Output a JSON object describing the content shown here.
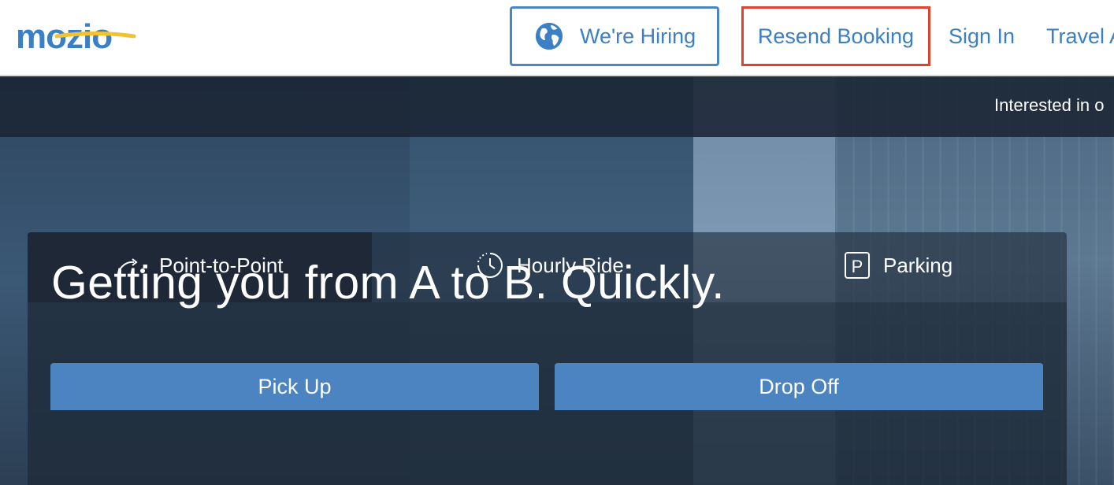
{
  "header": {
    "logo_text": "mozio",
    "nav": {
      "hiring_label": "We're Hiring",
      "resend_label": "Resend Booking",
      "signin_label": "Sign In",
      "travel_label": "Travel A"
    },
    "icons": {
      "hiring": "globe-icon"
    }
  },
  "banner": {
    "text": "Interested in o"
  },
  "booking": {
    "tabs": [
      {
        "label": "Point-to-Point",
        "icon": "route-arrow-icon",
        "active": true
      },
      {
        "label": "Hourly Ride",
        "icon": "clock-icon",
        "active": false
      },
      {
        "label": "Parking",
        "icon": "parking-icon",
        "active": false
      }
    ],
    "headline": "Getting you from A to B. Quickly.",
    "pickup_label": "Pick Up",
    "dropoff_label": "Drop Off"
  },
  "colors": {
    "brand_blue": "#3b7fc4",
    "button_blue": "#4c84c2",
    "logo_yellow": "#f2c230",
    "highlight_red": "#e0422b"
  }
}
